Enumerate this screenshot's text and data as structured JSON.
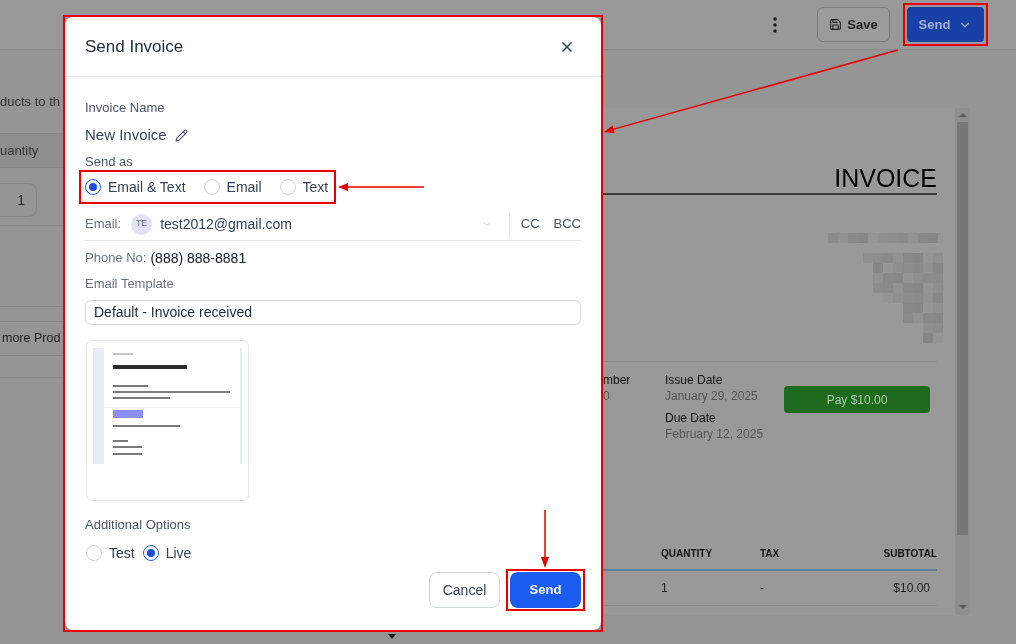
{
  "top_bar": {
    "save_button": {
      "label": "Save"
    },
    "send_button": {
      "label": "Send",
      "highlighted": true
    }
  },
  "products_panel": {
    "intro_text": "ducts to th",
    "column_header": "uantity",
    "quantity": "1",
    "add_button": "more Prod"
  },
  "invoice_preview": {
    "title": "INVOICE",
    "number": {
      "label": "mber",
      "value": "0"
    },
    "dates": [
      {
        "label": "Issue Date",
        "value": "January 29, 2025"
      },
      {
        "label": "Due Date",
        "value": "February 12, 2025"
      }
    ],
    "pay_button": "Pay $10.00",
    "items_table": {
      "columns": [
        "QUANTITY",
        "TAX",
        "SUBTOTAL"
      ],
      "rows": [
        [
          "1",
          "-",
          "$10.00"
        ]
      ]
    }
  },
  "dialog": {
    "title": "Send Invoice",
    "highlighted": true,
    "invoice_name": {
      "label": "Invoice Name",
      "value": "New Invoice"
    },
    "send_as": {
      "label": "Send as",
      "highlighted": true,
      "options": [
        {
          "label": "Email & Text",
          "selected": true
        },
        {
          "label": "Email",
          "selected": false
        },
        {
          "label": "Text",
          "selected": false
        }
      ]
    },
    "email": {
      "label": "Email:",
      "recipient": {
        "initials": "TE",
        "address": "test2012@gmail.com"
      },
      "links": [
        "CC",
        "BCC"
      ]
    },
    "phone": {
      "label": "Phone No:",
      "value": "(888) 888-8881"
    },
    "email_template": {
      "label": "Email Template",
      "value": "Default - Invoice received"
    },
    "additional_options": {
      "label": "Additional Options",
      "options": [
        {
          "label": "Test",
          "selected": false
        },
        {
          "label": "Live",
          "selected": true
        }
      ]
    },
    "buttons": [
      {
        "label": "Cancel",
        "kind": "secondary",
        "highlighted": false
      },
      {
        "label": "Send",
        "kind": "primary",
        "highlighted": true
      }
    ]
  }
}
